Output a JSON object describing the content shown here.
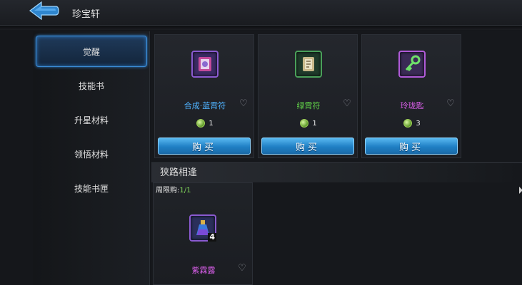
{
  "header": {
    "title": "珍宝轩"
  },
  "sidebar": {
    "items": [
      {
        "label": "觉醒",
        "active": true
      },
      {
        "label": "技能书",
        "active": false
      },
      {
        "label": "升星材料",
        "active": false
      },
      {
        "label": "领悟材料",
        "active": false
      },
      {
        "label": "技能书匣",
        "active": false
      }
    ]
  },
  "shop": {
    "items": [
      {
        "name": "合成·蓝霄符",
        "name_color": "#4fb2ff",
        "price": "1",
        "buy_label": "购买",
        "icon": "blue-talisman-icon"
      },
      {
        "name": "绿霄符",
        "name_color": "#63d64a",
        "price": "1",
        "buy_label": "购买",
        "icon": "green-talisman-icon"
      },
      {
        "name": "玲珑匙",
        "name_color": "#d85ee8",
        "price": "3",
        "buy_label": "购买",
        "icon": "jade-key-icon"
      }
    ],
    "section_title": "狭路相逢",
    "limit_label": "周限购:",
    "limit_count": "1/1",
    "special_item": {
      "name": "紫霖露",
      "name_color": "#d85ee8",
      "quantity": "4",
      "icon": "purple-potion-icon"
    }
  },
  "colors": {
    "accent": "#2d7bc9",
    "buy_button": "#1f7fc4",
    "coin": "#7fc43a"
  }
}
